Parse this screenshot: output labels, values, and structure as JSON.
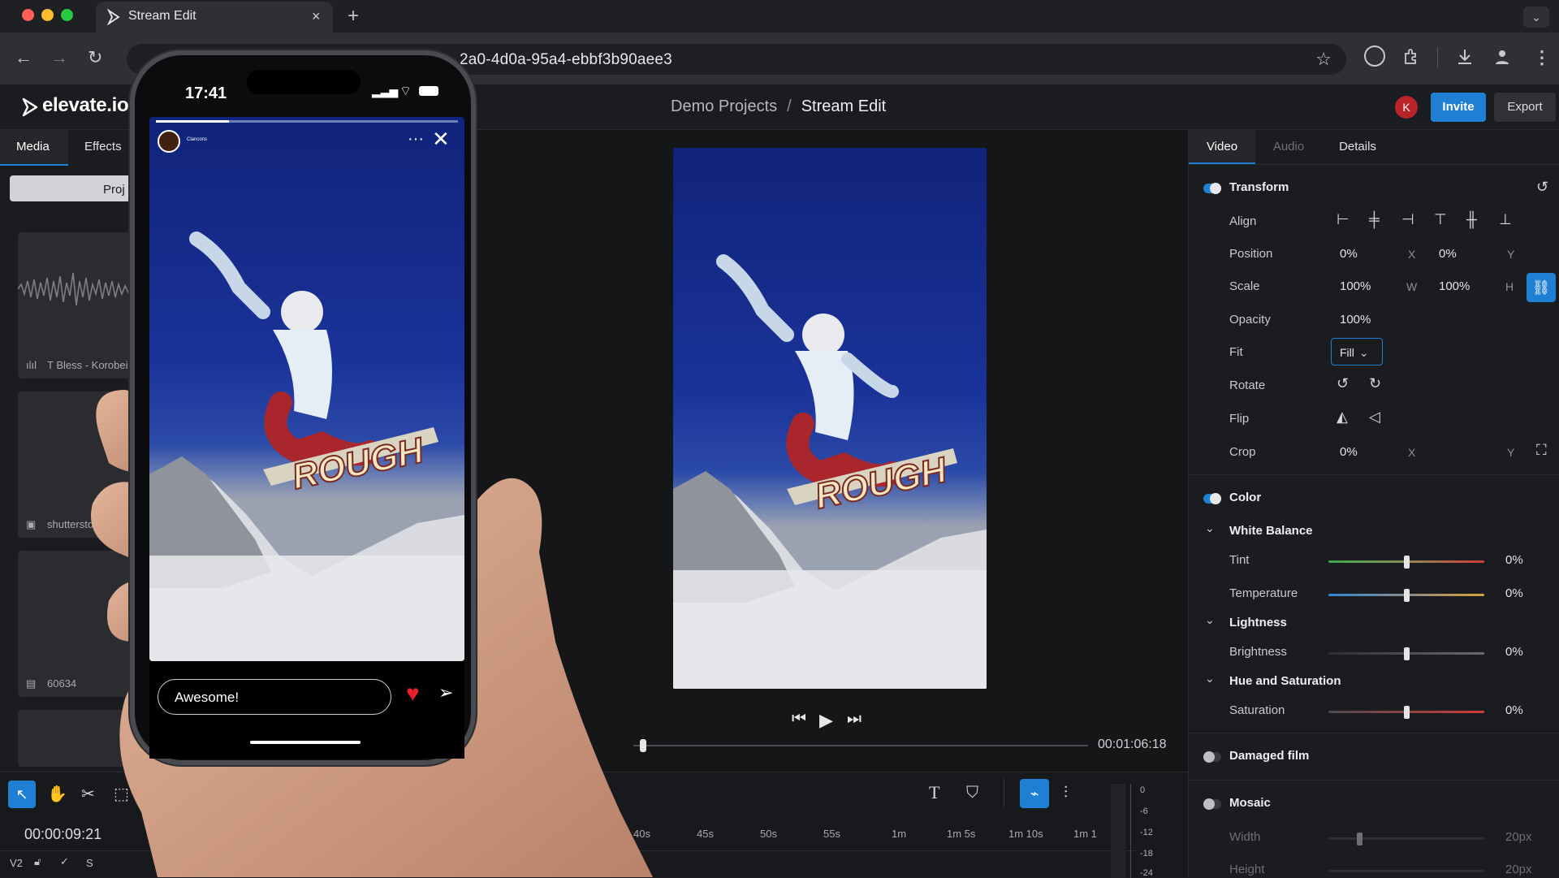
{
  "browser": {
    "tab_title": "Stream Edit",
    "tab_close": "×",
    "new_tab": "+",
    "url": "2a0-4d0a-95a4-ebbf3b90aee3"
  },
  "app": {
    "logo": "elevate.io",
    "breadcrumb": {
      "parent": "Demo Projects",
      "separator": "/",
      "current": "Stream Edit"
    },
    "avatar_initial": "K",
    "invite_label": "Invite",
    "export_label": "Export"
  },
  "left_panel": {
    "tabs": [
      "Media",
      "Effects"
    ],
    "project_button": "Proj",
    "media_items": [
      {
        "label": "T Bless - Korobei",
        "icon": "audio-wave-icon"
      },
      {
        "label": "shutterstock_237",
        "icon": "image-icon"
      },
      {
        "label": "60634",
        "icon": "film-icon"
      }
    ]
  },
  "preview": {
    "timecode": "00:01:06:18",
    "overlay_text": "ROUGH"
  },
  "timeline": {
    "current_time": "00:00:09:21",
    "ruler_labels": [
      "40s",
      "45s",
      "50s",
      "55s",
      "1m",
      "1m 5s",
      "1m 10s",
      "1m 1"
    ],
    "track_label": "V2",
    "track_flag": "S",
    "meter_labels": [
      "0",
      "-6",
      "-12",
      "-18",
      "-24"
    ]
  },
  "phone": {
    "time": "17:41",
    "story_user": "Clancons",
    "comment_placeholder": "Awesome!",
    "more_dots": "···"
  },
  "right_panel": {
    "tabs": [
      "Video",
      "Audio",
      "Details"
    ],
    "transform": {
      "title": "Transform",
      "align_label": "Align",
      "position": {
        "label": "Position",
        "x": "0%",
        "x_axis": "X",
        "y": "0%",
        "y_axis": "Y"
      },
      "scale": {
        "label": "Scale",
        "w": "100%",
        "w_axis": "W",
        "h": "100%",
        "h_axis": "H"
      },
      "opacity": {
        "label": "Opacity",
        "value": "100%"
      },
      "fit": {
        "label": "Fit",
        "value": "Fill"
      },
      "rotate_label": "Rotate",
      "flip_label": "Flip",
      "crop": {
        "label": "Crop",
        "x": "0%",
        "x_axis": "X",
        "y_axis": "Y"
      }
    },
    "color": {
      "title": "Color",
      "white_balance": "White Balance",
      "tint": {
        "label": "Tint",
        "value": "0%",
        "level": 0.5
      },
      "temperature": {
        "label": "Temperature",
        "value": "0%",
        "level": 0.5
      },
      "lightness": "Lightness",
      "brightness": {
        "label": "Brightness",
        "value": "0%",
        "level": 0.5
      },
      "hue_saturation": "Hue and Saturation",
      "saturation": {
        "label": "Saturation",
        "value": "0%",
        "level": 0.5
      }
    },
    "damaged_film": {
      "title": "Damaged film"
    },
    "mosaic": {
      "title": "Mosaic",
      "width": {
        "label": "Width",
        "value": "20px"
      },
      "height": {
        "label": "Height",
        "value": "20px"
      }
    }
  },
  "colors": {
    "accent": "#1e7fd3",
    "avatar": "#b8242a",
    "heart": "#e8202a"
  }
}
